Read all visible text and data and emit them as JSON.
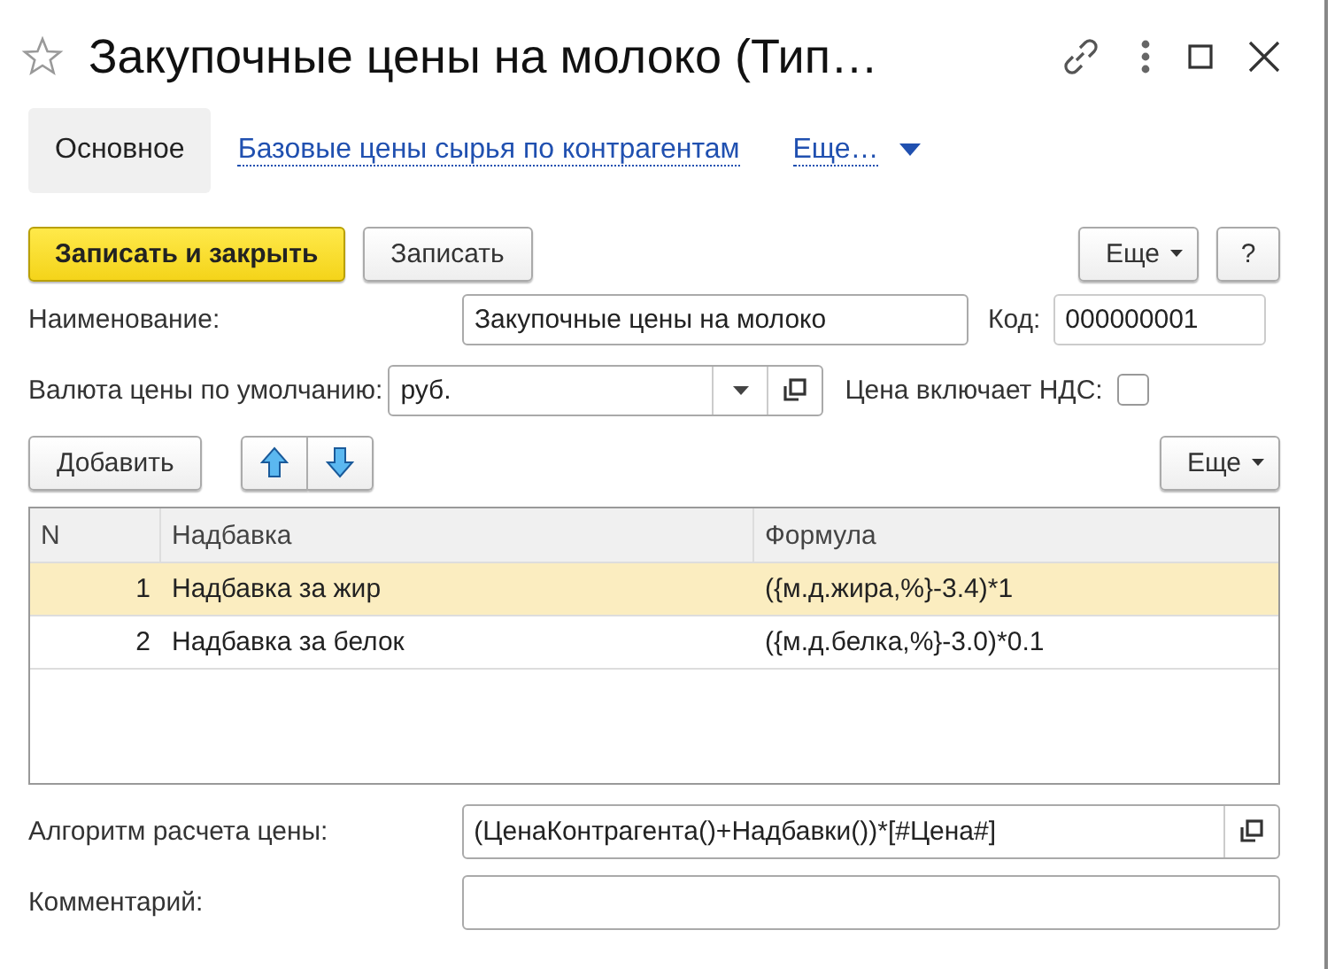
{
  "window": {
    "title": "Закупочные цены на молоко (Тип…"
  },
  "tabs": [
    {
      "label": "Основное",
      "selected": true
    },
    {
      "label": "Базовые цены сырья по контрагентам",
      "selected": false
    },
    {
      "label": "Еще…",
      "selected": false,
      "kind": "more"
    }
  ],
  "toolbar": {
    "buttons": [
      {
        "label": "Записать и закрыть",
        "kind": "primary"
      },
      {
        "label": "Записать",
        "kind": "plain"
      }
    ],
    "more": "Еще",
    "help": "?"
  },
  "fields": {
    "name": {
      "label": "Наименование:",
      "value": "Закупочные цены на молоко"
    },
    "code": {
      "label": "Код:",
      "value": "000000001"
    },
    "currency": {
      "label": "Валюта цены по умолчанию:",
      "value": "руб."
    },
    "vat": {
      "label": "Цена включает НДС:",
      "checked": false
    }
  },
  "table_toolbar": {
    "add": "Добавить",
    "more": "Еще"
  },
  "table": {
    "columns": [
      "N",
      "Надбавка",
      "Формула"
    ],
    "rows": [
      {
        "cells": [
          "1",
          "Надбавка за жир",
          "({м.д.жира,%}-3.4)*1"
        ],
        "selected": true
      },
      {
        "cells": [
          "2",
          "Надбавка за белок",
          "({м.д.белка,%}-3.0)*0.1"
        ],
        "selected": false
      }
    ]
  },
  "algorithm": {
    "label": "Алгоритм расчета цены:",
    "value": "(ЦенаКонтрагента()+Надбавки())*[#Цена#]"
  },
  "comment": {
    "label": "Комментарий:"
  }
}
